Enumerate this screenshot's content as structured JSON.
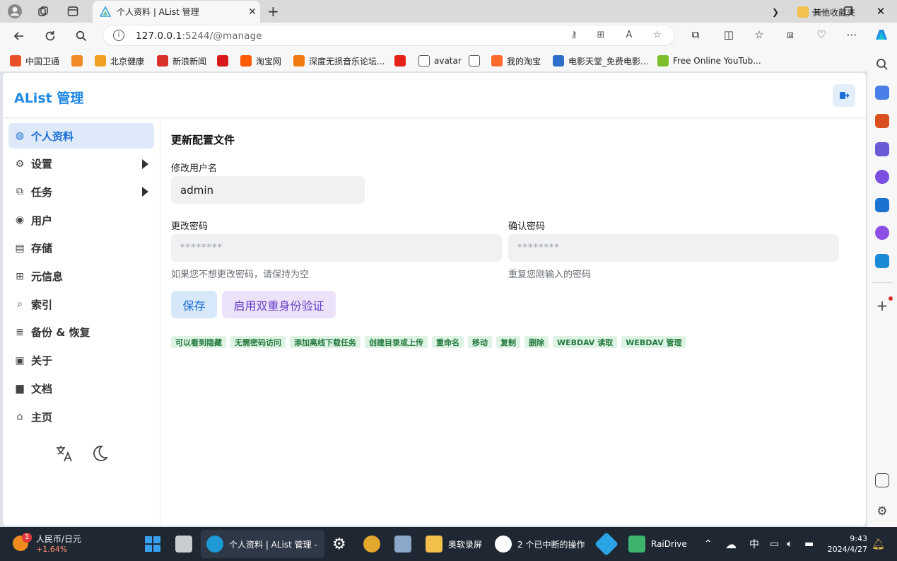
{
  "browser": {
    "tab_title": "个人资料 | AList 管理",
    "url_host": "127.0.0.1",
    "url_rest": ":5244/@manage",
    "bookmarks": [
      {
        "label": "中国卫通",
        "color": "#e8502a"
      },
      {
        "label": "",
        "color": "#f08a24"
      },
      {
        "label": "北京健康",
        "color": "#f0a020"
      },
      {
        "label": "新浪新闻",
        "color": "#d8302a"
      },
      {
        "label": "",
        "color": "#d61a1a"
      },
      {
        "label": "淘宝网",
        "color": "#ff5a00"
      },
      {
        "label": "深度无损音乐论坛...",
        "color": "#f07a10"
      },
      {
        "label": "",
        "color": "#e62117"
      },
      {
        "label": "avatar",
        "color": "#ffffff"
      },
      {
        "label": "",
        "color": "#ffffff"
      },
      {
        "label": "我的淘宝",
        "color": "#ff6a2a"
      },
      {
        "label": "电影天堂_免费电影...",
        "color": "#2d6ec9"
      },
      {
        "label": "Free Online YouTub...",
        "color": "#7cbf2a"
      }
    ],
    "other_bookmarks": "其他收藏夹"
  },
  "app": {
    "brand": "AList 管理",
    "sidebar": [
      {
        "label": "个人资料",
        "icon": "globe-icon",
        "active": true
      },
      {
        "label": "设置",
        "icon": "gear-icon",
        "expandable": true
      },
      {
        "label": "任务",
        "icon": "tasks-icon",
        "expandable": true
      },
      {
        "label": "用户",
        "icon": "user-circle-icon"
      },
      {
        "label": "存储",
        "icon": "database-icon"
      },
      {
        "label": "元信息",
        "icon": "meta-icon"
      },
      {
        "label": "索引",
        "icon": "search-icon"
      },
      {
        "label": "备份 & 恢复",
        "icon": "backup-icon"
      },
      {
        "label": "关于",
        "icon": "about-icon"
      },
      {
        "label": "文档",
        "icon": "book-icon"
      },
      {
        "label": "主页",
        "icon": "home-icon"
      }
    ],
    "profile": {
      "section_title": "更新配置文件",
      "username_label": "修改用户名",
      "username_value": "admin",
      "password_label": "更改密码",
      "password_placeholder": "********",
      "password_help": "如果您不想更改密码，请保持为空",
      "confirm_label": "确认密码",
      "confirm_placeholder": "********",
      "confirm_help": "重复您刚输入的密码",
      "save_button": "保存",
      "twofa_button": "启用双重身份验证",
      "permissions": [
        "可以看到隐藏",
        "无需密码访问",
        "添加离线下载任务",
        "创建目录或上传",
        "重命名",
        "移动",
        "复制",
        "删除",
        "WEBDAV 读取",
        "WEBDAV 管理"
      ]
    }
  },
  "taskbar": {
    "weather_title": "人民币/日元",
    "weather_change": "+1.64%",
    "weather_badge": "1",
    "edge_task": "个人资料 | AList 管理 - ",
    "recorder_task": "奥软录屏",
    "clock_task": "2 个已中断的操作",
    "raidrive_task": "RaiDrive",
    "ime": "中",
    "time": "9:43",
    "date": "2024/4/27"
  }
}
